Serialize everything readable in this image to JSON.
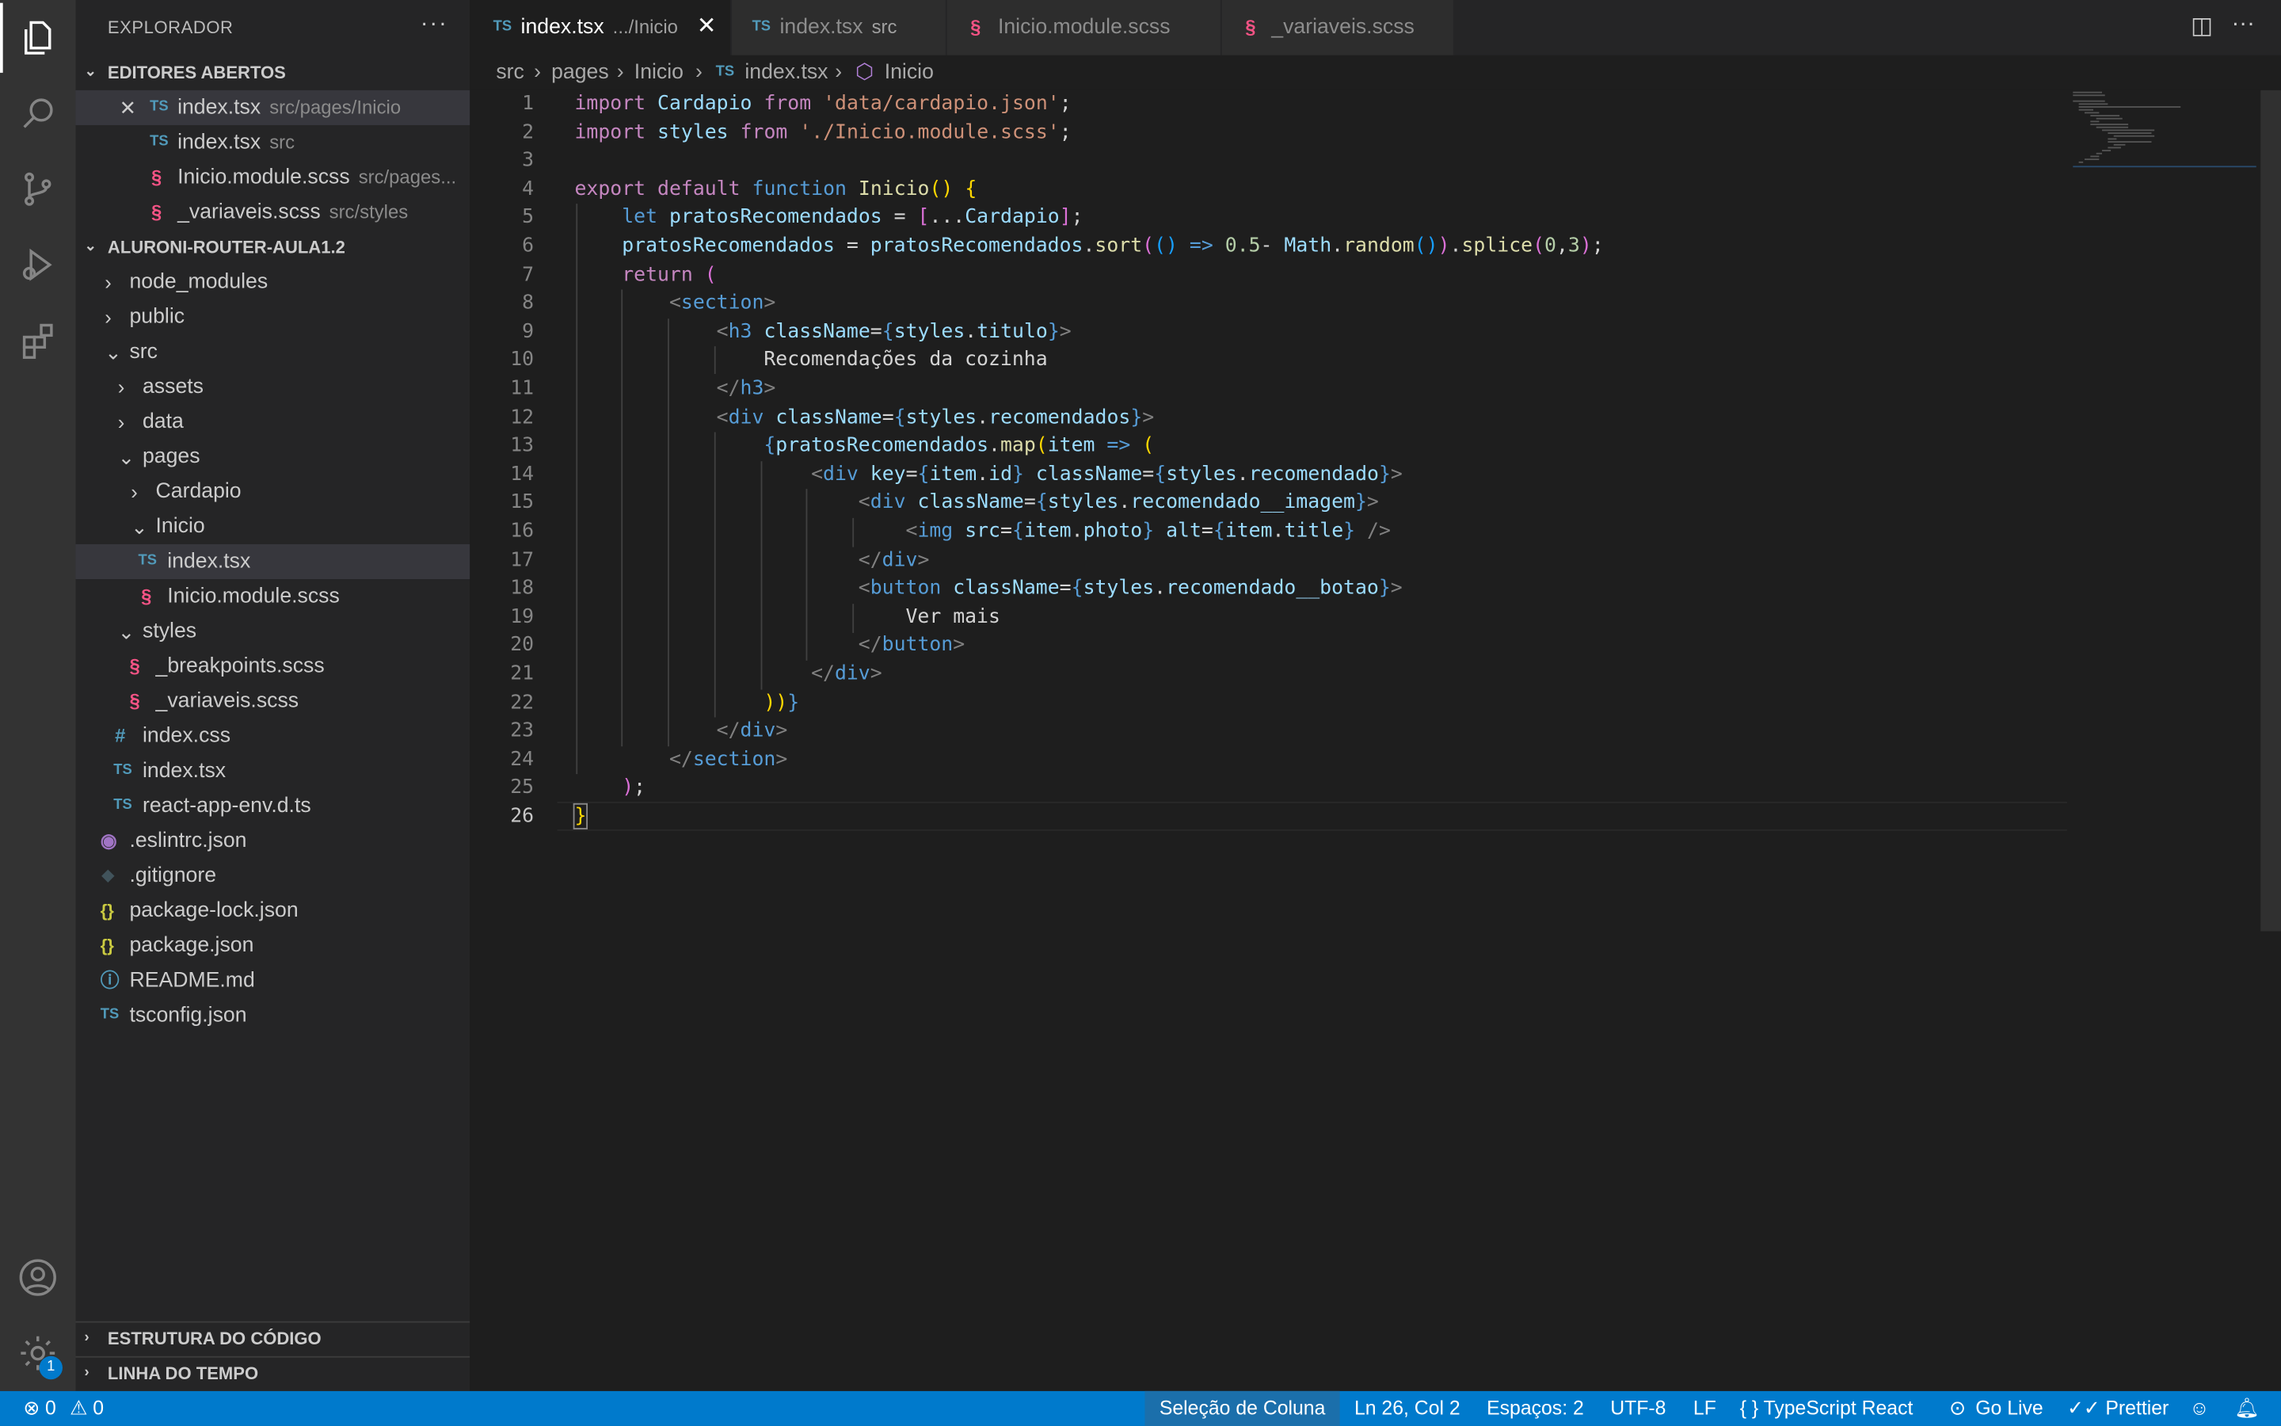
{
  "sidebar": {
    "title": "EXPLORADOR",
    "more": "···",
    "open_editors_header": "EDITORES ABERTOS",
    "open_editors": [
      {
        "close": "✕",
        "icon": "TS",
        "name": "index.tsx",
        "desc": "src/pages/Inicio"
      },
      {
        "icon": "TS",
        "name": "index.tsx",
        "desc": "src"
      },
      {
        "icon": "§",
        "name": "Inicio.module.scss",
        "desc": "src/pages..."
      },
      {
        "icon": "§",
        "name": "_variaveis.scss",
        "desc": "src/styles"
      }
    ],
    "project_header": "ALURONI-ROUTER-AULA1.2",
    "tree": [
      {
        "name": "node_modules",
        "twisty": "›"
      },
      {
        "name": "public",
        "twisty": "›"
      },
      {
        "name": "src",
        "twisty": "⌄"
      },
      {
        "name": "assets",
        "twisty": "›"
      },
      {
        "name": "data",
        "twisty": "›"
      },
      {
        "name": "pages",
        "twisty": "⌄"
      },
      {
        "name": "Cardapio",
        "twisty": "›"
      },
      {
        "name": "Inicio",
        "twisty": "⌄"
      },
      {
        "name": "index.tsx",
        "icon": "TS"
      },
      {
        "name": "Inicio.module.scss",
        "icon": "§"
      },
      {
        "name": "styles",
        "twisty": "⌄"
      },
      {
        "name": "_breakpoints.scss",
        "icon": "§"
      },
      {
        "name": "_variaveis.scss",
        "icon": "§"
      },
      {
        "name": "index.css",
        "icon": "#"
      },
      {
        "name": "index.tsx",
        "icon": "TS"
      },
      {
        "name": "react-app-env.d.ts",
        "icon": "TS"
      },
      {
        "name": ".eslintrc.json",
        "icon": "◉"
      },
      {
        "name": ".gitignore",
        "icon": "◆"
      },
      {
        "name": "package-lock.json",
        "icon": "{}"
      },
      {
        "name": "package.json",
        "icon": "{}"
      },
      {
        "name": "README.md",
        "icon": "ⓘ"
      },
      {
        "name": "tsconfig.json",
        "icon": "TS"
      }
    ],
    "outline_header": "ESTRUTURA DO CÓDIGO",
    "timeline_header": "LINHA DO TEMPO",
    "settings_badge": "1"
  },
  "tabs": [
    {
      "icon": "TS",
      "name": "index.tsx",
      "desc": ".../Inicio",
      "close": "✕"
    },
    {
      "icon": "TS",
      "name": "index.tsx",
      "desc": "src"
    },
    {
      "icon": "§",
      "name": "Inicio.module.scss"
    },
    {
      "icon": "§",
      "name": "_variaveis.scss"
    }
  ],
  "tab_actions": {
    "split": "◫",
    "more": "···"
  },
  "breadcrumb": {
    "src": "src",
    "sep": "›",
    "pages": "pages",
    "inicio": "Inicio",
    "file_icon": "TS",
    "file": "index.tsx",
    "symbol_icon": "⬡",
    "symbol": "Inicio"
  },
  "editor": {
    "line_numbers": [
      "1",
      "2",
      "3",
      "4",
      "5",
      "6",
      "7",
      "8",
      "9",
      "10",
      "11",
      "12",
      "13",
      "14",
      "15",
      "16",
      "17",
      "18",
      "19",
      "20",
      "21",
      "22",
      "23",
      "24",
      "25",
      "26"
    ],
    "current_line": 26
  },
  "status": {
    "errors": "⊗ 0",
    "warnings": "⚠ 0",
    "selection_mode": "Seleção de Coluna",
    "position": "Ln 26, Col 2",
    "spaces": "Espaços: 2",
    "encoding": "UTF-8",
    "eol": "LF",
    "language": "{ } TypeScript React",
    "golive": "Go Live",
    "prettier": "✓✓ Prettier"
  },
  "colors": {
    "statusbar": "#007acc",
    "activitybar": "#333333",
    "sidebar": "#252526",
    "editor": "#1e1e1e"
  }
}
